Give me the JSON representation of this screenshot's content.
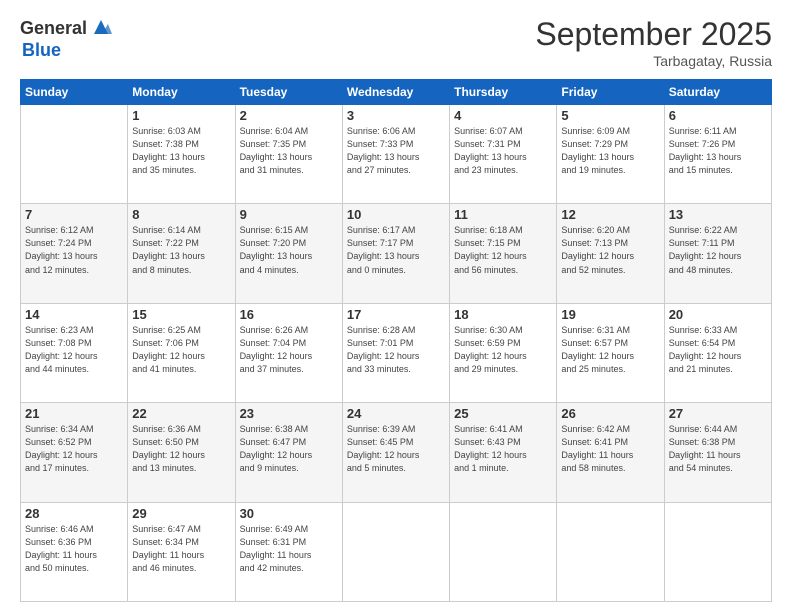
{
  "header": {
    "logo_line1": "General",
    "logo_line2": "Blue",
    "month_title": "September 2025",
    "location": "Tarbagatay, Russia"
  },
  "weekdays": [
    "Sunday",
    "Monday",
    "Tuesday",
    "Wednesday",
    "Thursday",
    "Friday",
    "Saturday"
  ],
  "weeks": [
    [
      {
        "day": "",
        "info": ""
      },
      {
        "day": "1",
        "info": "Sunrise: 6:03 AM\nSunset: 7:38 PM\nDaylight: 13 hours\nand 35 minutes."
      },
      {
        "day": "2",
        "info": "Sunrise: 6:04 AM\nSunset: 7:35 PM\nDaylight: 13 hours\nand 31 minutes."
      },
      {
        "day": "3",
        "info": "Sunrise: 6:06 AM\nSunset: 7:33 PM\nDaylight: 13 hours\nand 27 minutes."
      },
      {
        "day": "4",
        "info": "Sunrise: 6:07 AM\nSunset: 7:31 PM\nDaylight: 13 hours\nand 23 minutes."
      },
      {
        "day": "5",
        "info": "Sunrise: 6:09 AM\nSunset: 7:29 PM\nDaylight: 13 hours\nand 19 minutes."
      },
      {
        "day": "6",
        "info": "Sunrise: 6:11 AM\nSunset: 7:26 PM\nDaylight: 13 hours\nand 15 minutes."
      }
    ],
    [
      {
        "day": "7",
        "info": "Sunrise: 6:12 AM\nSunset: 7:24 PM\nDaylight: 13 hours\nand 12 minutes."
      },
      {
        "day": "8",
        "info": "Sunrise: 6:14 AM\nSunset: 7:22 PM\nDaylight: 13 hours\nand 8 minutes."
      },
      {
        "day": "9",
        "info": "Sunrise: 6:15 AM\nSunset: 7:20 PM\nDaylight: 13 hours\nand 4 minutes."
      },
      {
        "day": "10",
        "info": "Sunrise: 6:17 AM\nSunset: 7:17 PM\nDaylight: 13 hours\nand 0 minutes."
      },
      {
        "day": "11",
        "info": "Sunrise: 6:18 AM\nSunset: 7:15 PM\nDaylight: 12 hours\nand 56 minutes."
      },
      {
        "day": "12",
        "info": "Sunrise: 6:20 AM\nSunset: 7:13 PM\nDaylight: 12 hours\nand 52 minutes."
      },
      {
        "day": "13",
        "info": "Sunrise: 6:22 AM\nSunset: 7:11 PM\nDaylight: 12 hours\nand 48 minutes."
      }
    ],
    [
      {
        "day": "14",
        "info": "Sunrise: 6:23 AM\nSunset: 7:08 PM\nDaylight: 12 hours\nand 44 minutes."
      },
      {
        "day": "15",
        "info": "Sunrise: 6:25 AM\nSunset: 7:06 PM\nDaylight: 12 hours\nand 41 minutes."
      },
      {
        "day": "16",
        "info": "Sunrise: 6:26 AM\nSunset: 7:04 PM\nDaylight: 12 hours\nand 37 minutes."
      },
      {
        "day": "17",
        "info": "Sunrise: 6:28 AM\nSunset: 7:01 PM\nDaylight: 12 hours\nand 33 minutes."
      },
      {
        "day": "18",
        "info": "Sunrise: 6:30 AM\nSunset: 6:59 PM\nDaylight: 12 hours\nand 29 minutes."
      },
      {
        "day": "19",
        "info": "Sunrise: 6:31 AM\nSunset: 6:57 PM\nDaylight: 12 hours\nand 25 minutes."
      },
      {
        "day": "20",
        "info": "Sunrise: 6:33 AM\nSunset: 6:54 PM\nDaylight: 12 hours\nand 21 minutes."
      }
    ],
    [
      {
        "day": "21",
        "info": "Sunrise: 6:34 AM\nSunset: 6:52 PM\nDaylight: 12 hours\nand 17 minutes."
      },
      {
        "day": "22",
        "info": "Sunrise: 6:36 AM\nSunset: 6:50 PM\nDaylight: 12 hours\nand 13 minutes."
      },
      {
        "day": "23",
        "info": "Sunrise: 6:38 AM\nSunset: 6:47 PM\nDaylight: 12 hours\nand 9 minutes."
      },
      {
        "day": "24",
        "info": "Sunrise: 6:39 AM\nSunset: 6:45 PM\nDaylight: 12 hours\nand 5 minutes."
      },
      {
        "day": "25",
        "info": "Sunrise: 6:41 AM\nSunset: 6:43 PM\nDaylight: 12 hours\nand 1 minute."
      },
      {
        "day": "26",
        "info": "Sunrise: 6:42 AM\nSunset: 6:41 PM\nDaylight: 11 hours\nand 58 minutes."
      },
      {
        "day": "27",
        "info": "Sunrise: 6:44 AM\nSunset: 6:38 PM\nDaylight: 11 hours\nand 54 minutes."
      }
    ],
    [
      {
        "day": "28",
        "info": "Sunrise: 6:46 AM\nSunset: 6:36 PM\nDaylight: 11 hours\nand 50 minutes."
      },
      {
        "day": "29",
        "info": "Sunrise: 6:47 AM\nSunset: 6:34 PM\nDaylight: 11 hours\nand 46 minutes."
      },
      {
        "day": "30",
        "info": "Sunrise: 6:49 AM\nSunset: 6:31 PM\nDaylight: 11 hours\nand 42 minutes."
      },
      {
        "day": "",
        "info": ""
      },
      {
        "day": "",
        "info": ""
      },
      {
        "day": "",
        "info": ""
      },
      {
        "day": "",
        "info": ""
      }
    ]
  ]
}
